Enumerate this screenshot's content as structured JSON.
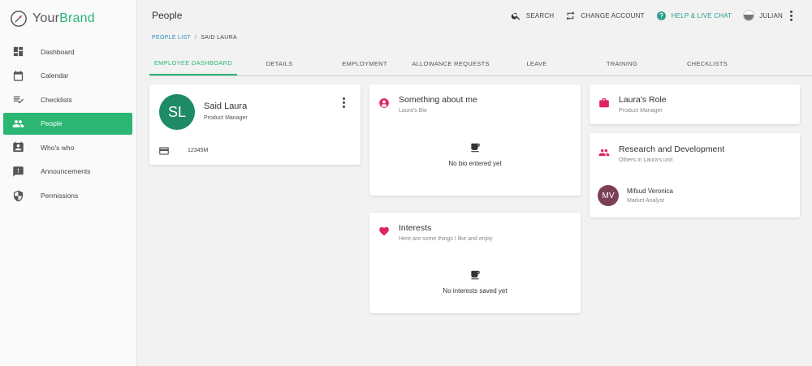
{
  "brand": {
    "prefix": "Your",
    "name": "Brand"
  },
  "sidebar": {
    "items": [
      {
        "label": "Dashboard",
        "icon": "dashboard-icon"
      },
      {
        "label": "Calendar",
        "icon": "calendar-icon"
      },
      {
        "label": "Checklists",
        "icon": "checklist-icon"
      },
      {
        "label": "People",
        "icon": "people-icon",
        "active": true
      },
      {
        "label": "Who's who",
        "icon": "contact-card-icon"
      },
      {
        "label": "Announcements",
        "icon": "announcement-icon"
      },
      {
        "label": "Permissions",
        "icon": "shield-icon"
      }
    ]
  },
  "header": {
    "title": "People",
    "search_label": "SEARCH",
    "change_account_label": "CHANGE ACCOUNT",
    "help_label": "HELP & LIVE CHAT",
    "user_label": "JULIAN"
  },
  "breadcrumb": {
    "parent": "PEOPLE LIST",
    "separator": "/",
    "current": "SAID LAURA"
  },
  "tabs": [
    {
      "label": "EMPLOYEE DASHBOARD",
      "active": true
    },
    {
      "label": "DETAILS"
    },
    {
      "label": "EMPLOYMENT"
    },
    {
      "label": "ALLOWANCE REQUESTS"
    },
    {
      "label": "LEAVE"
    },
    {
      "label": "TRAINING"
    },
    {
      "label": "CHECKLISTS"
    }
  ],
  "profile": {
    "initials": "SL",
    "name": "Said Laura",
    "role": "Product Manager",
    "id_number": "12345M"
  },
  "about": {
    "title": "Something about me",
    "subtitle": "Laura's Bio",
    "empty_text": "No bio entered yet"
  },
  "interests": {
    "title": "Interests",
    "subtitle": "Here are some things I like and enjoy",
    "empty_text": "No interests saved yet"
  },
  "role_card": {
    "title": "Laura's Role",
    "subtitle": "Product Manager"
  },
  "unit": {
    "title": "Research and Development",
    "subtitle": "Others in Laura's unit",
    "members": [
      {
        "initials": "MV",
        "name": "Mifsud Veronica",
        "role": "Market Analyst"
      }
    ]
  },
  "colors": {
    "accent": "#2bb673",
    "link": "#2a8fc1",
    "icon_pink": "#e0245e",
    "avatar_green": "#1f8a66",
    "avatar_plum": "#7b3f58"
  }
}
